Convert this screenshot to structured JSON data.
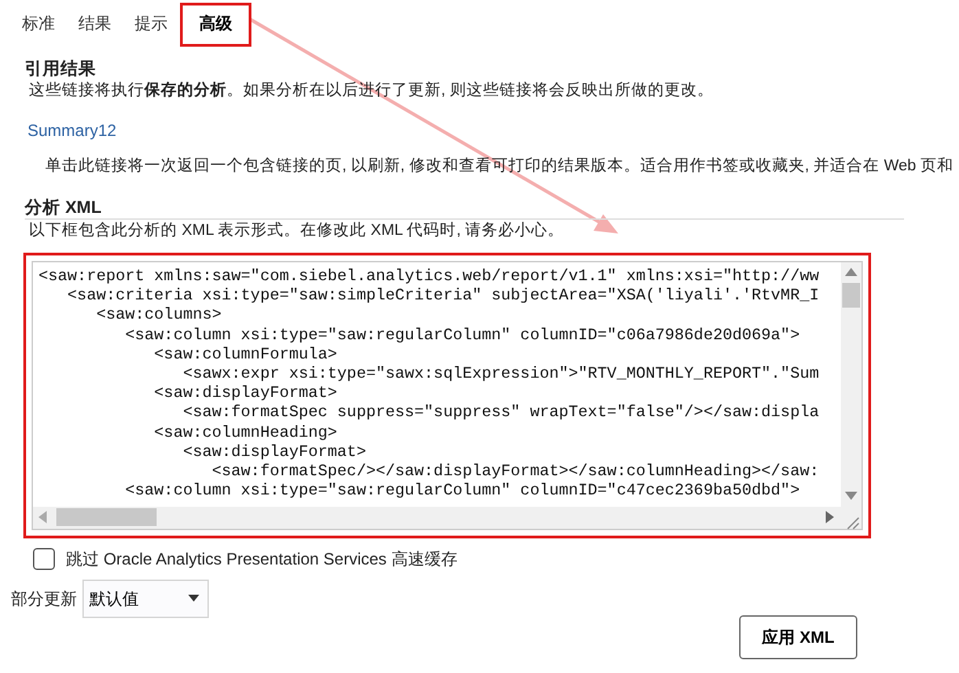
{
  "tabs": [
    {
      "label": "标准",
      "selected": false,
      "highlighted": false
    },
    {
      "label": "结果",
      "selected": false,
      "highlighted": false
    },
    {
      "label": "提示",
      "selected": false,
      "highlighted": false
    },
    {
      "label": "高级",
      "selected": true,
      "highlighted": true
    }
  ],
  "reference": {
    "title": "引用结果",
    "description": "这些链接将执行**保存的分析**。如果分析在以后进行了更新, 则这些链接将会反映出所做的更改。",
    "link": "Summary12",
    "link_note": "单击此链接将一次返回一个包含链接的页, 以刷新, 修改和查看可打印的结果版本。适合用作书签或收藏夹, 并适合在 Web 页和"
  },
  "xml": {
    "title": "分析 XML",
    "description": "以下框包含此分析的 XML 表示形式。在修改此 XML 代码时, 请务必小心。",
    "highlighted": true,
    "lines": [
      "<saw:report xmlns:saw=\"com.siebel.analytics.web/report/v1.1\" xmlns:xsi=\"http://ww",
      "   <saw:criteria xsi:type=\"saw:simpleCriteria\" subjectArea=\"XSA('liyali'.'RtvMR_I",
      "      <saw:columns>",
      "         <saw:column xsi:type=\"saw:regularColumn\" columnID=\"c06a7986de20d069a\">",
      "            <saw:columnFormula>",
      "               <sawx:expr xsi:type=\"sawx:sqlExpression\">\"RTV_MONTHLY_REPORT\".\"Sum",
      "            <saw:displayFormat>",
      "               <saw:formatSpec suppress=\"suppress\" wrapText=\"false\"/></saw:displa",
      "            <saw:columnHeading>",
      "               <saw:displayFormat>",
      "                  <saw:formatSpec/></saw:displayFormat></saw:columnHeading></saw:",
      "         <saw:column xsi:type=\"saw:regularColumn\" columnID=\"c47cec2369ba50dbd\">"
    ]
  },
  "bypass_cache": {
    "label": "跳过 Oracle Analytics Presentation Services 高速缓存",
    "checked": false
  },
  "partial_update": {
    "label": "部分更新",
    "value": "默认值"
  },
  "apply_button": "应用 XML"
}
